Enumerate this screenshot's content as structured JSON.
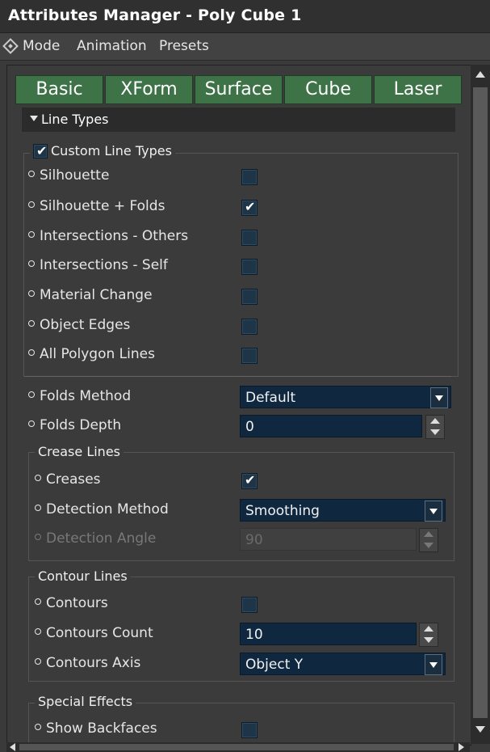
{
  "window": {
    "title": "Attributes Manager - Poly Cube 1"
  },
  "menu": {
    "items": [
      "Mode",
      "Animation",
      "Presets"
    ]
  },
  "tabs": [
    "Basic",
    "XForm",
    "Surface",
    "Cube",
    "Laser"
  ],
  "section": {
    "label": "Line Types"
  },
  "custom_line_types": {
    "label": "Custom Line Types",
    "checked": true,
    "items": [
      {
        "label": "Silhouette",
        "checked": false
      },
      {
        "label": "Silhouette + Folds",
        "checked": true
      },
      {
        "label": "Intersections - Others",
        "checked": false
      },
      {
        "label": "Intersections - Self",
        "checked": false
      },
      {
        "label": "Material Change",
        "checked": false
      },
      {
        "label": "Object Edges",
        "checked": false
      },
      {
        "label": "All Polygon Lines",
        "checked": false
      }
    ]
  },
  "folds": {
    "method_label": "Folds Method",
    "method_value": "Default",
    "depth_label": "Folds Depth",
    "depth_value": "0"
  },
  "crease_lines": {
    "title": "Crease Lines",
    "creases_label": "Creases",
    "creases_checked": true,
    "detection_method_label": "Detection Method",
    "detection_method_value": "Smoothing",
    "detection_angle_label": "Detection Angle",
    "detection_angle_value": "90"
  },
  "contour_lines": {
    "title": "Contour Lines",
    "contours_label": "Contours",
    "contours_checked": false,
    "count_label": "Contours Count",
    "count_value": "10",
    "axis_label": "Contours Axis",
    "axis_value": "Object Y"
  },
  "special_effects": {
    "title": "Special Effects",
    "show_backfaces_label": "Show Backfaces",
    "show_backfaces_checked": false
  },
  "check_glyph": "✔",
  "colors": {
    "tab_green": "#3e7247",
    "field_blue": "#10283f",
    "checkbox_blue": "#1e3447"
  }
}
